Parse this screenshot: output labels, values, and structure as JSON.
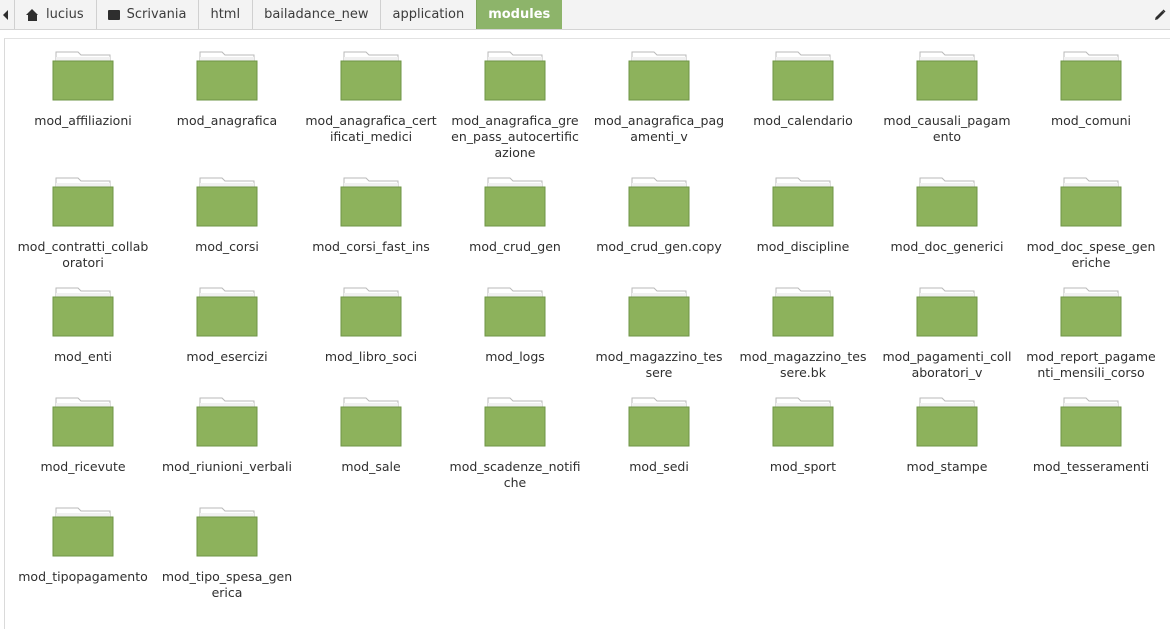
{
  "breadcrumbs": [
    {
      "label": "lucius",
      "icon": "home-icon"
    },
    {
      "label": "Scrivania",
      "icon": "desktop-icon"
    },
    {
      "label": "html"
    },
    {
      "label": "bailadance_new"
    },
    {
      "label": "application"
    },
    {
      "label": "modules",
      "active": true
    }
  ],
  "colors": {
    "accent": "#8db46a",
    "folder_fill": "#8db25c",
    "folder_tab": "#ffffff"
  },
  "folders": [
    "mod_affiliazioni",
    "mod_anagrafica",
    "mod_anagrafica_certificati_medici",
    "mod_anagrafica_green_pass_autocertificazione",
    "mod_anagrafica_pagamenti_v",
    "mod_calendario",
    "mod_causali_pagamento",
    "mod_comuni",
    "mod_contratti_collaboratori",
    "mod_corsi",
    "mod_corsi_fast_ins",
    "mod_crud_gen",
    "mod_crud_gen.copy",
    "mod_discipline",
    "mod_doc_generici",
    "mod_doc_spese_generiche",
    "mod_enti",
    "mod_esercizi",
    "mod_libro_soci",
    "mod_logs",
    "mod_magazzino_tessere",
    "mod_magazzino_tessere.bk",
    "mod_pagamenti_collaboratori_v",
    "mod_report_pagamenti_mensili_corso",
    "mod_ricevute",
    "mod_riunioni_verbali",
    "mod_sale",
    "mod_scadenze_notifiche",
    "mod_sedi",
    "mod_sport",
    "mod_stampe",
    "mod_tesseramenti",
    "mod_tipopagamento",
    "mod_tipo_spesa_generica"
  ]
}
